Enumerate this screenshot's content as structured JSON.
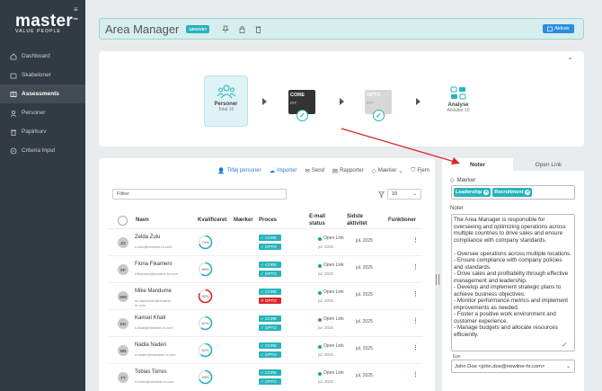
{
  "sidebar": {
    "logo": "master",
    "logo_tm": "™",
    "logo_sub": "VALUE PEOPLE",
    "items": [
      {
        "label": "Dashboard",
        "icon": "home-icon"
      },
      {
        "label": "Skabeloner",
        "icon": "template-icon"
      },
      {
        "label": "Assessments",
        "icon": "book-icon",
        "active": true
      },
      {
        "label": "Personer",
        "icon": "person-icon"
      },
      {
        "label": "Papirkurv",
        "icon": "trash-icon"
      },
      {
        "label": "Criteria Input",
        "icon": "input-icon"
      }
    ]
  },
  "header": {
    "title": "Area Manager",
    "status_badge": "UDGIVET",
    "activate_label": "Aktivér"
  },
  "process": {
    "personer": {
      "label": "Personer",
      "sub": "Total 10"
    },
    "core": {
      "name": "CORE",
      "sub": "INT"
    },
    "opto": {
      "name": "OPTO",
      "sub": "INT"
    },
    "analyse": {
      "label": "Analyse",
      "sub": "Afsluttet 10"
    }
  },
  "toolbar": {
    "add_people": "Tilføj personer",
    "import": "Importer",
    "send": "Send",
    "reports": "Rapporter",
    "tags": "Mærker",
    "remove": "Fjern"
  },
  "filter": {
    "placeholder": "Filtrer",
    "page_size": "10"
  },
  "table": {
    "headers": {
      "name": "Navn",
      "qualified": "Kvalificeret",
      "tags": "Mærker",
      "process": "Proces",
      "email_status_1": "E-mail",
      "email_status_2": "status",
      "last_activity_1": "Sidste",
      "last_activity_2": "aktivitet",
      "functions": "Funktioner"
    },
    "rows": [
      {
        "initials": "ZZ",
        "name": "Zelda Zulu",
        "email": "z.zulu@newline-hr.com",
        "score": 70,
        "score_label": "70%",
        "ring_color": "#27b3bb",
        "chips": [
          "✓ CORE",
          "✓ OPTO"
        ],
        "chip_colors": [
          "#27b3bb",
          "#27b3bb"
        ],
        "status": "Open Link",
        "status_date": "jul. 2025",
        "activity": "jul. 2025"
      },
      {
        "initials": "FF",
        "name": "Fiona Fikameni",
        "email": "f.fikameni@newline-hr.com",
        "score": 60,
        "score_label": "60%",
        "ring_color": "#27b3bb",
        "chips": [
          "✓ CORE",
          "✓ OPTO"
        ],
        "chip_colors": [
          "#27b3bb",
          "#27b3bb"
        ],
        "status": "Open Link",
        "status_date": "jul. 2025",
        "activity": "jul. 2025"
      },
      {
        "initials": "MM",
        "name": "Mike Mandume",
        "email": "m.mandume@newline-hr.com",
        "score": 82,
        "score_label": "82%",
        "ring_color": "#d9282b",
        "chips": [
          "✓ CORE",
          "✕ OPTO"
        ],
        "chip_colors": [
          "#27b3bb",
          "#d9282b"
        ],
        "status": "Open Link",
        "status_date": "jul. 2025",
        "activity": "jul. 2025"
      },
      {
        "initials": "KK",
        "name": "Kamari Khati",
        "email": "k.khati@newline-hr.com",
        "score": 61,
        "score_label": "61%",
        "ring_color": "#27b3bb",
        "chips": [
          "✓ CORE",
          "✓ OPTO"
        ],
        "chip_colors": [
          "#27b3bb",
          "#27b3bb"
        ],
        "status": "Open Link",
        "status_date": "jul. 2025",
        "activity": "jul. 2025"
      },
      {
        "initials": "NN",
        "name": "Nadia Naderi",
        "email": "n.naderi@newline-hr.com",
        "score": 62,
        "score_label": "62%",
        "ring_color": "#27b3bb",
        "chips": [
          "✓ CORE",
          "✓ OPTO"
        ],
        "chip_colors": [
          "#27b3bb",
          "#27b3bb"
        ],
        "status": "Open Link",
        "status_date": "jul. 2025",
        "activity": "jul. 2025"
      },
      {
        "initials": "TT",
        "name": "Tobias Torres",
        "email": "t.torres@newline-hr.com",
        "score": 69,
        "score_label": "69%",
        "ring_color": "#27b3bb",
        "chips": [
          "✓ CORE",
          "✓ OPTO"
        ],
        "chip_colors": [
          "#27b3bb",
          "#27b3bb"
        ],
        "status": "Open Link",
        "status_date": "jul. 2025",
        "activity": "jul. 2025"
      }
    ]
  },
  "panel": {
    "tab_notes": "Noter",
    "tab_link": "Open Link",
    "tags_label": "Mærker",
    "tags": [
      "Leadership",
      "Recruitment"
    ],
    "notes_label": "Noter",
    "notes_text": "The Area Manager is responsible for overseeing and optimizing operations across multiple countries to drive sales and ensure compliance with company standards.\n\n- Oversee operations across multiple locations.\n- Ensure compliance with company policies and standards.\n- Drive sales and profitability through effective management and leadership.\n- Develop and implement strategic plans to achieve business objectives.\n- Monitor performance metrics and implement improvements as needed.\n- Foster a positive work environment and customer experience.\n- Manage budgets and allocate resources efficiently.",
    "owner_label": "Ejer",
    "owner_value": "John Doe <john.doe@newline-hr.com>"
  },
  "colors": {
    "accent": "#27b3bb",
    "primary": "#2b8fe0",
    "danger": "#d9282b",
    "sidebar": "#323b43",
    "annotation": "#d9282b"
  }
}
